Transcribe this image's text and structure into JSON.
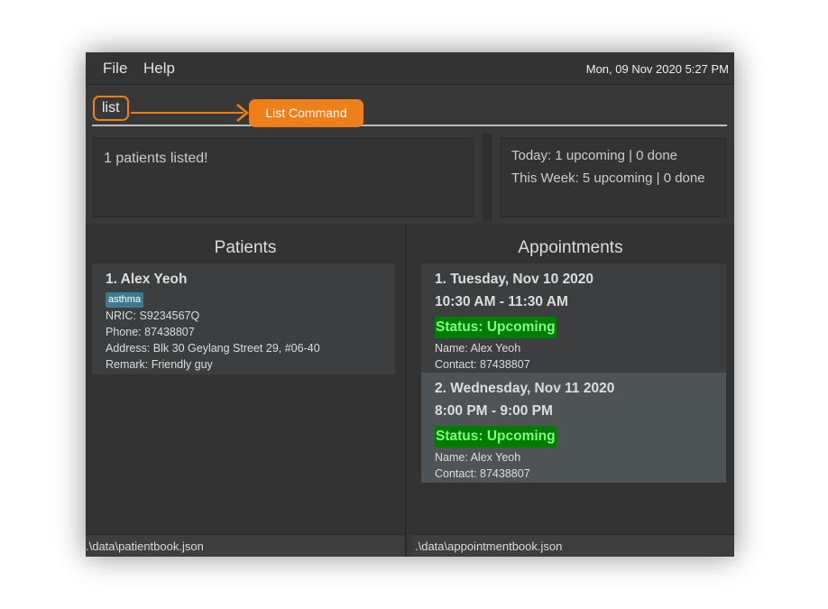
{
  "menu": {
    "file": "File",
    "help": "Help",
    "clock": "Mon, 09 Nov 2020 5:27 PM"
  },
  "command": {
    "value": "list",
    "annotation": "List Command",
    "accent": "#ee7f1a"
  },
  "result": {
    "message": "1 patients listed!"
  },
  "summary": {
    "today": "Today: 1 upcoming | 0 done",
    "week": "This Week: 5 upcoming | 0 done"
  },
  "patients": {
    "heading": "Patients",
    "items": [
      {
        "title": "1.  Alex Yeoh",
        "tag": "asthma",
        "nric": "NRIC: S9234567Q",
        "phone": "Phone: 87438807",
        "address": "Address: Blk 30 Geylang Street 29, #06-40",
        "remark": "Remark: Friendly guy"
      }
    ]
  },
  "appointments": {
    "heading": "Appointments",
    "items": [
      {
        "title": "1.  Tuesday, Nov 10 2020",
        "time": "10:30 AM - 11:30 AM",
        "status": "Status: Upcoming",
        "name": "Name: Alex Yeoh",
        "contact": "Contact: 87438807"
      },
      {
        "title": "2.  Wednesday, Nov 11 2020",
        "time": "8:00 PM - 9:00 PM",
        "status": "Status: Upcoming",
        "name": "Name: Alex Yeoh",
        "contact": "Contact: 87438807"
      }
    ]
  },
  "status_bar": {
    "patients_file": ".\\data\\patientbook.json",
    "appointments_file": ".\\data\\appointmentbook.json"
  }
}
